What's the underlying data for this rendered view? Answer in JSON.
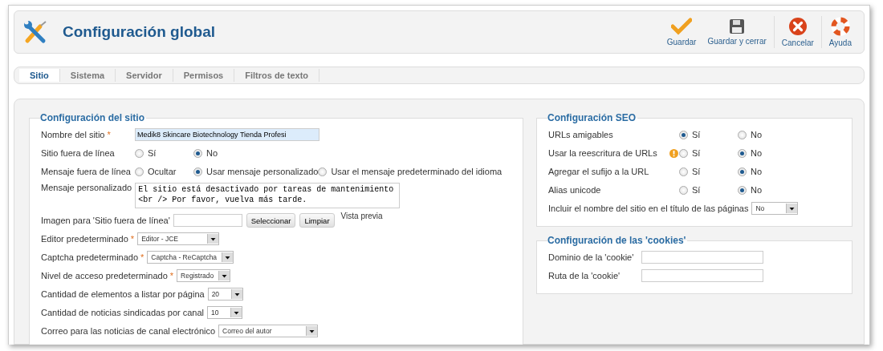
{
  "header": {
    "title": "Configuración global"
  },
  "toolbar": [
    {
      "kind": "save",
      "label": "Guardar",
      "separator_before": false
    },
    {
      "kind": "save-close",
      "label": "Guardar y cerrar",
      "separator_before": false
    },
    {
      "kind": "cancel",
      "label": "Cancelar",
      "separator_before": true
    },
    {
      "kind": "help",
      "label": "Ayuda",
      "separator_before": true
    }
  ],
  "tabs": [
    {
      "label": "Sitio",
      "selected": true
    },
    {
      "label": "Sistema",
      "selected": false
    },
    {
      "label": "Servidor",
      "selected": false
    },
    {
      "label": "Permisos",
      "selected": false
    },
    {
      "label": "Filtros de texto",
      "selected": false
    }
  ],
  "site": {
    "title": "Configuración del sitio",
    "rows": [
      {
        "kind": "text",
        "label": "Nombre del sitio",
        "marker": "*",
        "value": "Medik8 Skincare Biotechnology Tienda Profesi"
      },
      {
        "kind": "radio",
        "label": "Sitio fuera de línea",
        "options": [
          {
            "label": "Sí",
            "selected": false
          },
          {
            "label": "No",
            "selected": true
          }
        ]
      },
      {
        "kind": "radio",
        "label": "Mensaje fuera de línea",
        "options": [
          {
            "label": "Ocultar",
            "selected": false
          },
          {
            "label": "Usar mensaje personalizado",
            "selected": true
          },
          {
            "label": "Usar el mensaje predeterminado del idioma",
            "selected": false
          }
        ]
      },
      {
        "kind": "textarea",
        "label": "Mensaje personalizado",
        "value": "El sitio está desactivado por tareas de mantenimiento <br /> Por favor, vuelva más tarde."
      },
      {
        "kind": "image",
        "label": "Imagen para 'Sitio fuera de línea'",
        "buttons": [
          "Seleccionar",
          "Limpiar"
        ],
        "preview": "Vista previa"
      },
      {
        "kind": "select",
        "label": "Editor predeterminado",
        "marker": "*",
        "value": "Editor - JCE"
      },
      {
        "kind": "select",
        "label": "Captcha predeterminado",
        "marker": "*",
        "value": "Captcha - ReCaptcha"
      },
      {
        "kind": "select",
        "label": "Nivel de acceso predeterminado",
        "marker": "*",
        "value": "Registrado"
      },
      {
        "kind": "select",
        "label": "Cantidad de elementos a listar por página",
        "value": "20"
      },
      {
        "kind": "select",
        "label": "Cantidad de noticias sindicadas por canal",
        "value": "10"
      },
      {
        "kind": "select",
        "label": "Correo para las noticias de canal electrónico",
        "value": "Correo del autor"
      }
    ]
  },
  "seo": {
    "title": "Configuración SEO",
    "rows": [
      {
        "kind": "radio",
        "label": "URLs amigables",
        "warning": false,
        "options": [
          {
            "label": "Sí",
            "selected": true
          },
          {
            "label": "No",
            "selected": false
          }
        ]
      },
      {
        "kind": "radio",
        "label": "Usar la reescritura de URLs",
        "warning": true,
        "options": [
          {
            "label": "Sí",
            "selected": false
          },
          {
            "label": "No",
            "selected": true
          }
        ]
      },
      {
        "kind": "radio",
        "label": "Agregar el sufijo a la URL",
        "warning": false,
        "options": [
          {
            "label": "Sí",
            "selected": false
          },
          {
            "label": "No",
            "selected": true
          }
        ]
      },
      {
        "kind": "radio",
        "label": "Alias unicode",
        "warning": false,
        "options": [
          {
            "label": "Sí",
            "selected": false
          },
          {
            "label": "No",
            "selected": true
          }
        ]
      },
      {
        "kind": "select",
        "label": "Incluir el nombre del sitio en el título de las páginas",
        "value": "No"
      }
    ]
  },
  "cookies": {
    "title": "Configuración de las 'cookies'",
    "rows": [
      {
        "kind": "text",
        "label": "Dominio de la 'cookie'"
      },
      {
        "kind": "text",
        "label": "Ruta de la 'cookie'"
      }
    ]
  }
}
